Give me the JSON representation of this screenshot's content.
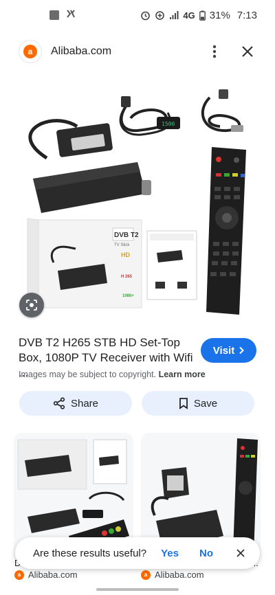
{
  "status_bar": {
    "network": "4G",
    "battery": "31%",
    "time": "7:13"
  },
  "header": {
    "favicon_letter": "a",
    "site": "Alibaba.com"
  },
  "result": {
    "title": "DVB T2 H265 STB HD Set-Top Box, 1080P TV Receiver with Wifi ...",
    "visit_label": "Visit",
    "copyright_text": "Images may be subject to copyright.",
    "learn_more": "Learn more"
  },
  "actions": {
    "share_label": "Share",
    "save_label": "Save"
  },
  "hero_image": {
    "box_brand": "DVB T2",
    "box_sub": "TV Stick",
    "box_hd": "HD",
    "box_h265": "H 265",
    "box_res": "1080+",
    "remote_display": "1500"
  },
  "related": [
    {
      "source": "Alibaba.com",
      "title_fragment": "D"
    },
    {
      "source": "Alibaba.com",
      "title_fragment": "..."
    }
  ],
  "toast": {
    "question": "Are these results useful?",
    "yes": "Yes",
    "no": "No"
  },
  "colors": {
    "accent": "#1a73e8",
    "pill_bg": "#e8f0fe",
    "brand": "#ff6a00"
  }
}
